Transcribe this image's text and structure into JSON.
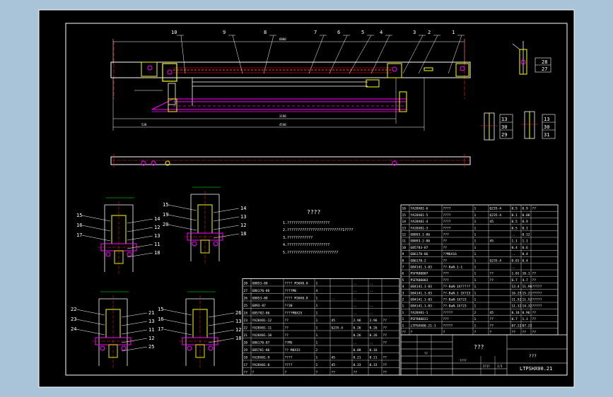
{
  "colors": {
    "viewport_bg": "#a9c4d8",
    "paper": "#000000",
    "frame": "#ffffff",
    "part_yellow": "#ffff00",
    "red": "#ff2020",
    "magenta": "#ff00ff",
    "cyan": "#00ffff",
    "green": "#00ff00",
    "white": "#ffffff"
  },
  "leaders_top": [
    "10",
    "9",
    "8",
    "7",
    "6",
    "5",
    "4",
    "3",
    "2",
    "1"
  ],
  "section_labels": {
    "top_right": [
      "28",
      "27"
    ],
    "right_mid_a": [
      "13",
      "30",
      "29"
    ],
    "right_mid_b": [
      "13",
      "30",
      "31"
    ],
    "sec_a": [
      "15",
      "16",
      "14",
      "12",
      "13",
      "11",
      "17",
      "18"
    ],
    "sec_b": [
      "15",
      "19",
      "14",
      "20",
      "13",
      "12",
      "18"
    ],
    "sec_c": [
      "22",
      "21",
      "13",
      "11",
      "23",
      "12",
      "24",
      "25"
    ],
    "sec_d": [
      "15",
      "16",
      "26",
      "13",
      "12",
      "17",
      "18"
    ]
  },
  "tech_requirements": {
    "title": "????",
    "lines": [
      "1.????????????????????",
      "2.??????????????????????????1????",
      "3.????????????",
      "4.????????????????????",
      "5.????????????????????????"
    ]
  },
  "bom_left": {
    "rows": [
      [
        "28",
        "GB853-88",
        "???? M30X0.8",
        "1",
        "",
        "..",
        "..",
        ""
      ],
      [
        "27",
        "GB6170-86",
        "????M6",
        "4",
        "",
        "..",
        "..",
        ""
      ],
      [
        "26",
        "GB853-88",
        "???? M30X0.8",
        "1",
        "..",
        "..",
        "",
        ""
      ],
      [
        "25",
        "GB93-87",
        "??30",
        "1",
        "",
        "..",
        "..",
        ""
      ],
      [
        "24",
        "GB5782-86",
        "????M8X25",
        "1",
        "",
        "..",
        "..",
        ""
      ],
      [
        "23",
        "YA28X01-12",
        "??",
        "1",
        "45",
        "2.96",
        "2.96",
        "??"
      ],
      [
        "22",
        "YA28X01-11",
        "??",
        "1",
        "Q235-A",
        "0.26",
        "0.26",
        "??"
      ],
      [
        "21",
        "YA28X01-10",
        "??",
        "1",
        "",
        "0.26",
        "0.26",
        "??"
      ],
      [
        "20",
        "GB6170-87",
        "??M5",
        "1",
        "",
        "..",
        "..",
        "??"
      ],
      [
        "19",
        "GB5781-86",
        "?? M8X15",
        "2",
        "",
        "0.08",
        "0.16",
        ""
      ],
      [
        "18",
        "YA28X01-9",
        "????",
        "1",
        "45",
        "0.21",
        "0.21",
        "??"
      ],
      [
        "17",
        "YA28X01-8",
        "????",
        "1",
        "45",
        "0.33",
        "0.33",
        "??"
      ],
      [
        "??",
        "?",
        "?",
        "?",
        "??",
        "??",
        "",
        "??"
      ]
    ]
  },
  "bom_right": {
    "rows": [
      [
        "16",
        "YA28X01-6",
        "????",
        "1",
        "Q235-A",
        "0.5",
        "0.9",
        "??"
      ],
      [
        "15",
        "YA28X01-5",
        "????",
        "1",
        "Q235-A",
        "0.1",
        "0.06",
        ""
      ],
      [
        "14",
        "YA28X01-4",
        "????",
        "1",
        "45",
        "0.5",
        "0.9",
        ""
      ],
      [
        "13",
        "YA28X01-3",
        "????",
        "1",
        "",
        "0.5",
        "0.1",
        ""
      ],
      [
        "12",
        "GB893.1-86",
        "???",
        "1",
        "",
        "..",
        "0.12",
        ""
      ],
      [
        "11",
        "GB893.2-86",
        "??",
        "1",
        "45",
        "1.1",
        "1.1",
        ""
      ],
      [
        "10",
        "GB5783-87",
        "??",
        "1",
        "",
        "0.4",
        "0.6",
        ""
      ],
      [
        "9",
        "GB6170-86",
        "??M6X16",
        "1",
        "",
        "..",
        "0.4",
        ""
      ],
      [
        "8",
        "GB6170-2",
        "??",
        "1",
        "Q235-A",
        "0.01",
        "0.4",
        ""
      ],
      [
        "7",
        "GB4141.1-83",
        "??-BaN.1-1",
        "1",
        "",
        "..",
        "",
        ""
      ],
      [
        "6",
        "PSFR00007",
        "???",
        "1",
        "??",
        "1.01",
        "10.1",
        "??"
      ],
      [
        "5",
        "PSFR00003",
        "???",
        "1",
        "??",
        "6.7",
        "4.7",
        "??"
      ],
      [
        "4",
        "GB4141.1-83",
        "??-BaN-1X?????",
        "1",
        "",
        "13.4",
        "11.96",
        "?????"
      ],
      [
        "3",
        "GB4141.1-83",
        "??-BaN.1 2X?23",
        "1",
        "",
        "16.25",
        "15.21",
        "?????"
      ],
      [
        "2",
        "GB4141.1-83",
        "??-BaN-1X?23",
        "1",
        "",
        "11.52",
        "11.52",
        "?????"
      ],
      [
        "1",
        "GB4141.1-83",
        "??-BaN-1X?23",
        "1",
        "",
        "11.32",
        "14.32",
        "?????"
      ],
      [
        "1",
        "YA28X01-1",
        "?????",
        "2",
        "45",
        "0.18",
        "0.96",
        "??"
      ],
      [
        "1",
        "PSFR00031",
        "???",
        "1",
        "??",
        "0.7",
        "1.1",
        "??"
      ],
      [
        "1",
        "LTPSHX00.21-1",
        "?????",
        "1",
        "??",
        "07.22",
        "07.22",
        ""
      ],
      [
        "??",
        "?",
        "?",
        "?",
        "?",
        "??",
        "??",
        "??"
      ]
    ]
  },
  "title_block": {
    "main_title": "???",
    "sub_title": "???",
    "drawing_number": "LTPSHX00.21",
    "small": [
      "????",
      "??",
      "2?1?",
      "1:5"
    ]
  }
}
